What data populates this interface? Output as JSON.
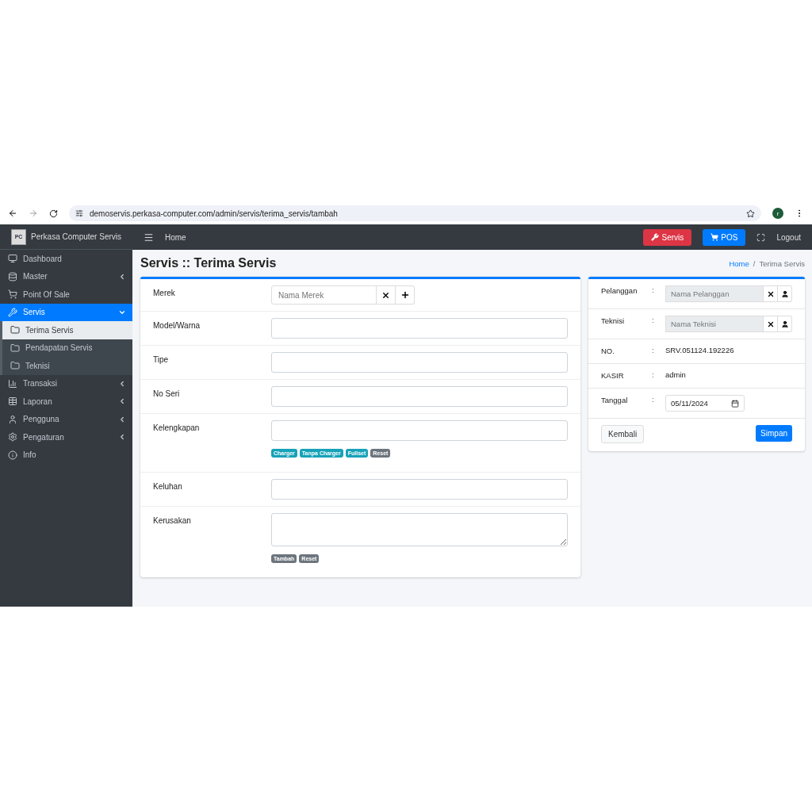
{
  "browser": {
    "url": "demoservis.perkasa-computer.com/admin/servis/terima_servis/tambah",
    "profile_initial": "r"
  },
  "brand": {
    "name": "Perkasa Computer Servis",
    "logo_text": "PC"
  },
  "topbar": {
    "home": "Home",
    "buttons": [
      {
        "label": "Servis",
        "kind": "danger"
      },
      {
        "label": "POS",
        "kind": "primary"
      }
    ],
    "logout": "Logout"
  },
  "sidebar": {
    "items": [
      {
        "label": "Dashboard",
        "selected": false
      },
      {
        "label": "Master",
        "selected": false,
        "expanded": false
      },
      {
        "label": "Point Of Sale",
        "selected": false
      },
      {
        "label": "Servis",
        "selected": true,
        "expanded": true,
        "children": [
          {
            "label": "Terima Servis",
            "selected": true
          },
          {
            "label": "Pendapatan Servis",
            "selected": false
          },
          {
            "label": "Teknisi",
            "selected": false
          }
        ]
      },
      {
        "label": "Transaksi",
        "selected": false,
        "expanded": false
      },
      {
        "label": "Laporan",
        "selected": false,
        "expanded": false
      },
      {
        "label": "Pengguna",
        "selected": false,
        "expanded": false
      },
      {
        "label": "Pengaturan",
        "selected": false,
        "expanded": false
      },
      {
        "label": "Info",
        "selected": false
      }
    ]
  },
  "page_title": "Servis :: Terima Servis",
  "breadcrumb": [
    {
      "label": "Home",
      "link": true
    },
    {
      "label": "/",
      "link": false
    },
    {
      "label": "Terima Servis",
      "link": false
    }
  ],
  "form": {
    "rows": [
      {
        "label": "Merek",
        "kind": "addon",
        "placeholder": "Nama Merek"
      },
      {
        "label": "Model/Warna",
        "kind": "input"
      },
      {
        "label": "Tipe",
        "kind": "input"
      },
      {
        "label": "No Seri",
        "kind": "input"
      },
      {
        "label": "Kelengkapan",
        "kind": "input",
        "tags": [
          {
            "label": "Charger",
            "color": "#17a2b8"
          },
          {
            "label": "Tanpa Charger",
            "color": "#17a2b8"
          },
          {
            "label": "Fullset",
            "color": "#17a2b8"
          },
          {
            "label": "Reset",
            "color": "#6c757d"
          }
        ]
      },
      {
        "label": "Keluhan",
        "kind": "input"
      },
      {
        "label": "Kerusakan",
        "kind": "textarea",
        "tags": [
          {
            "label": "Tambah",
            "color": "#6c757d"
          },
          {
            "label": "Reset",
            "color": "#6c757d"
          }
        ]
      }
    ]
  },
  "side_panel": {
    "rows": [
      {
        "label": "Pelanggan",
        "colon": ":",
        "kind": "picker",
        "placeholder": "Nama Pelanggan"
      },
      {
        "label": "Teknisi",
        "colon": ":",
        "kind": "picker",
        "placeholder": "Nama Teknisi"
      },
      {
        "label": "NO.",
        "colon": ":",
        "kind": "text",
        "value": "SRV.051124.192226"
      },
      {
        "label": "KASIR",
        "colon": ":",
        "kind": "text",
        "value": "admin"
      },
      {
        "label": "Tanggal",
        "colon": ":",
        "kind": "date",
        "value": "05/11/2024"
      }
    ],
    "back_button": "Kembali",
    "save_button": "Simpan"
  }
}
